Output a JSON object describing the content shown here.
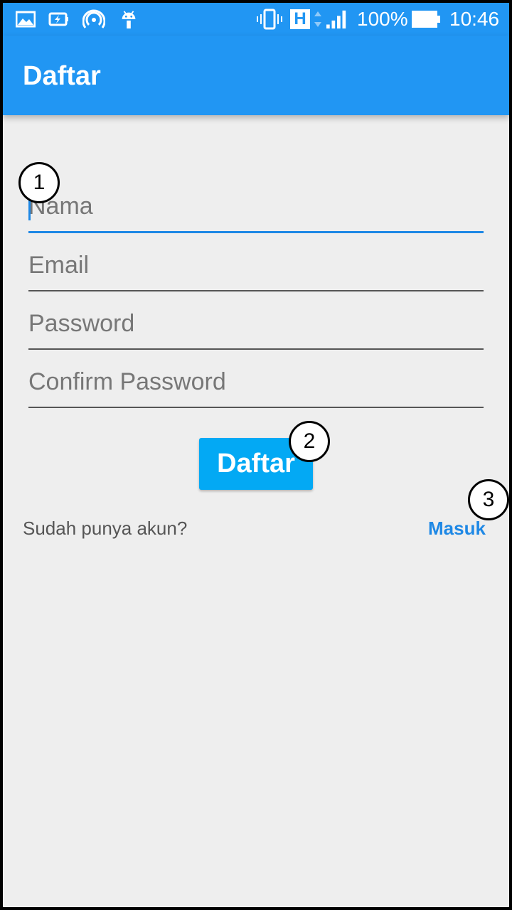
{
  "status_bar": {
    "battery_text": "100%",
    "time": "10:46",
    "network_letter": "H",
    "icons": [
      "gallery-icon",
      "battery-saver-icon",
      "hotspot-icon",
      "android-icon",
      "vibrate-icon",
      "network-h-icon",
      "signal-icon",
      "battery-icon"
    ]
  },
  "app_bar": {
    "title": "Daftar"
  },
  "form": {
    "name_placeholder": "Nama",
    "email_placeholder": "Email",
    "password_placeholder": "Password",
    "confirm_password_placeholder": "Confirm Password",
    "submit_label": "Daftar"
  },
  "footer": {
    "question": "Sudah punya akun?",
    "login_link": "Masuk"
  },
  "callouts": [
    "1",
    "2",
    "3"
  ],
  "colors": {
    "primary": "#2196f3",
    "button": "#03a9f4",
    "background": "#eeeeee",
    "link": "#1e88e5"
  }
}
